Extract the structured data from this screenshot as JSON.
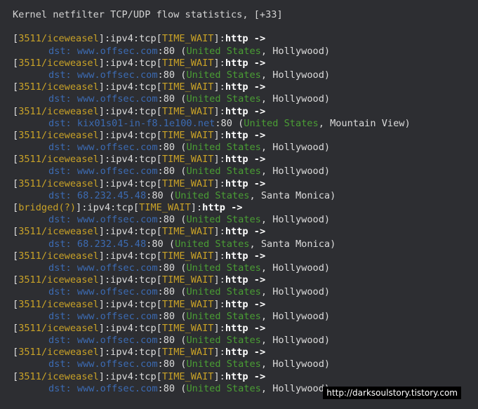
{
  "header": "Kernel netfilter TCP/UDP flow statistics, [+33]",
  "flows": [
    {
      "proc": "3511/iceweasel",
      "proto": "ipv4",
      "l4": "tcp",
      "state": "TIME_WAIT",
      "app": "http",
      "host": "www.offsec.com",
      "port": "80",
      "country": "United States",
      "city": "Hollywood"
    },
    {
      "proc": "3511/iceweasel",
      "proto": "ipv4",
      "l4": "tcp",
      "state": "TIME_WAIT",
      "app": "http",
      "host": "www.offsec.com",
      "port": "80",
      "country": "United States",
      "city": "Hollywood"
    },
    {
      "proc": "3511/iceweasel",
      "proto": "ipv4",
      "l4": "tcp",
      "state": "TIME_WAIT",
      "app": "http",
      "host": "www.offsec.com",
      "port": "80",
      "country": "United States",
      "city": "Hollywood"
    },
    {
      "proc": "3511/iceweasel",
      "proto": "ipv4",
      "l4": "tcp",
      "state": "TIME_WAIT",
      "app": "http",
      "host": "kix01s01-in-f8.1e100.net",
      "port": "80",
      "country": "United States",
      "city": "Mountain View"
    },
    {
      "proc": "3511/iceweasel",
      "proto": "ipv4",
      "l4": "tcp",
      "state": "TIME_WAIT",
      "app": "http",
      "host": "www.offsec.com",
      "port": "80",
      "country": "United States",
      "city": "Hollywood"
    },
    {
      "proc": "3511/iceweasel",
      "proto": "ipv4",
      "l4": "tcp",
      "state": "TIME_WAIT",
      "app": "http",
      "host": "www.offsec.com",
      "port": "80",
      "country": "United States",
      "city": "Hollywood"
    },
    {
      "proc": "3511/iceweasel",
      "proto": "ipv4",
      "l4": "tcp",
      "state": "TIME_WAIT",
      "app": "http",
      "host": "68.232.45.48",
      "port": "80",
      "country": "United States",
      "city": "Santa Monica"
    },
    {
      "proc": "bridged(?)",
      "proto": "ipv4",
      "l4": "tcp",
      "state": "TIME_WAIT",
      "app": "http",
      "host": "www.offsec.com",
      "port": "80",
      "country": "United States",
      "city": "Hollywood"
    },
    {
      "proc": "3511/iceweasel",
      "proto": "ipv4",
      "l4": "tcp",
      "state": "TIME_WAIT",
      "app": "http",
      "host": "68.232.45.48",
      "port": "80",
      "country": "United States",
      "city": "Santa Monica"
    },
    {
      "proc": "3511/iceweasel",
      "proto": "ipv4",
      "l4": "tcp",
      "state": "TIME_WAIT",
      "app": "http",
      "host": "www.offsec.com",
      "port": "80",
      "country": "United States",
      "city": "Hollywood"
    },
    {
      "proc": "3511/iceweasel",
      "proto": "ipv4",
      "l4": "tcp",
      "state": "TIME_WAIT",
      "app": "http",
      "host": "www.offsec.com",
      "port": "80",
      "country": "United States",
      "city": "Hollywood"
    },
    {
      "proc": "3511/iceweasel",
      "proto": "ipv4",
      "l4": "tcp",
      "state": "TIME_WAIT",
      "app": "http",
      "host": "www.offsec.com",
      "port": "80",
      "country": "United States",
      "city": "Hollywood"
    },
    {
      "proc": "3511/iceweasel",
      "proto": "ipv4",
      "l4": "tcp",
      "state": "TIME_WAIT",
      "app": "http",
      "host": "www.offsec.com",
      "port": "80",
      "country": "United States",
      "city": "Hollywood"
    },
    {
      "proc": "3511/iceweasel",
      "proto": "ipv4",
      "l4": "tcp",
      "state": "TIME_WAIT",
      "app": "http",
      "host": "www.offsec.com",
      "port": "80",
      "country": "United States",
      "city": "Hollywood"
    },
    {
      "proc": "3511/iceweasel",
      "proto": "ipv4",
      "l4": "tcp",
      "state": "TIME_WAIT",
      "app": "http",
      "host": "www.offsec.com",
      "port": "80",
      "country": "United States",
      "city": "Hollywood"
    }
  ],
  "watermark": "http://darksoulstory.tistory.com",
  "colors": {
    "background": "#2d2e32",
    "process": "#c9a227",
    "host": "#3c6bb3",
    "country": "#4a9e34"
  }
}
